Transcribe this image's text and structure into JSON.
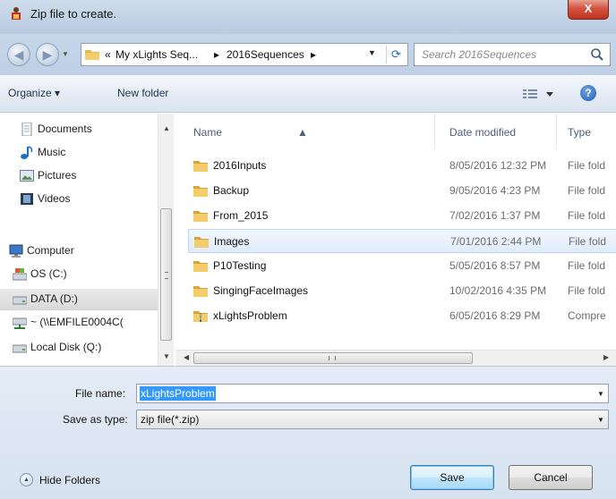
{
  "window": {
    "title": "Zip file to create.",
    "close_label": "X"
  },
  "address": {
    "overflow": "«",
    "crumbs": [
      "My xLights Seq...",
      "2016Sequences"
    ],
    "separator": "▸"
  },
  "search": {
    "placeholder": "Search 2016Sequences"
  },
  "toolbar": {
    "organize_label": "Organize ▾",
    "new_folder_label": "New folder",
    "help_label": "?"
  },
  "nav": {
    "items": [
      {
        "label": "Documents",
        "icon": "documents-icon"
      },
      {
        "label": "Music",
        "icon": "music-icon"
      },
      {
        "label": "Pictures",
        "icon": "pictures-icon"
      },
      {
        "label": "Videos",
        "icon": "videos-icon"
      },
      {
        "label": "Computer",
        "icon": "computer-icon"
      },
      {
        "label": "OS (C:)",
        "icon": "drive-c-icon"
      },
      {
        "label": "DATA (D:)",
        "icon": "drive-d-icon"
      },
      {
        "label": "~ (\\\\EMFILE0004C(",
        "icon": "network-drive-icon"
      },
      {
        "label": "Local Disk (Q:)",
        "icon": "drive-q-icon"
      }
    ]
  },
  "columns": {
    "name": "Name",
    "date": "Date modified",
    "type": "Type"
  },
  "files": [
    {
      "name": "2016Inputs",
      "date": "8/05/2016 12:32 PM",
      "type": "File fold",
      "kind": "folder"
    },
    {
      "name": "Backup",
      "date": "9/05/2016 4:23 PM",
      "type": "File fold",
      "kind": "folder"
    },
    {
      "name": "From_2015",
      "date": "7/02/2016 1:37 PM",
      "type": "File fold",
      "kind": "folder"
    },
    {
      "name": "Images",
      "date": "7/01/2016 2:44 PM",
      "type": "File fold",
      "kind": "folder"
    },
    {
      "name": "P10Testing",
      "date": "5/05/2016 8:57 PM",
      "type": "File fold",
      "kind": "folder"
    },
    {
      "name": "SingingFaceImages",
      "date": "10/02/2016 4:35 PM",
      "type": "File fold",
      "kind": "folder"
    },
    {
      "name": "xLightsProblem",
      "date": "6/05/2016 8:29 PM",
      "type": "Compre",
      "kind": "zip"
    }
  ],
  "form": {
    "file_name_label": "File name:",
    "file_name_value": "xLightsProblem",
    "save_type_label": "Save as type:",
    "save_type_value": "zip file(*.zip)"
  },
  "footer": {
    "hide_folders_label": "Hide Folders",
    "save_label": "Save",
    "cancel_label": "Cancel"
  },
  "colors": {
    "selection": "#3399ff",
    "folder": "#e8b64a",
    "titlebar": "#c3d3e6"
  }
}
